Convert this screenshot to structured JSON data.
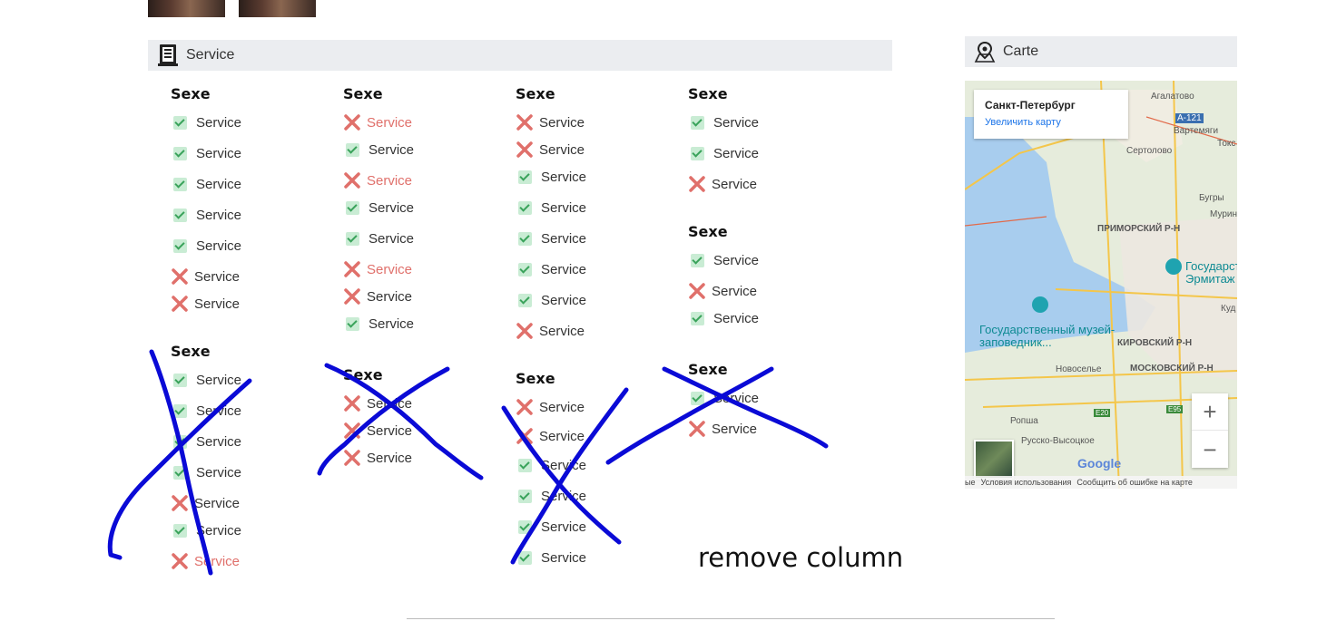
{
  "service_panel": {
    "title": "Service",
    "icon": "book-icon"
  },
  "map_panel": {
    "title": "Carte",
    "icon": "map-pin-icon"
  },
  "map": {
    "city": "Санкт-Петербург",
    "enlarge_link": "Увеличить карту",
    "zoom_in": "+",
    "zoom_out": "−",
    "labels": {
      "agalatovo": "Агалатово",
      "a121": "А-121",
      "vartemyagi": "Вартемяги",
      "toksovo": "Токс",
      "sertolovo": "Сертолово",
      "bugry": "Бугры",
      "murino": "Мурино",
      "primorsky": "ПРИМОРСКИЙ Р-Н",
      "hermitage": "Государственный Эрмитаж",
      "kud": "Куд",
      "museum": "Государственный музей-заповедник...",
      "kirovsky": "КИРОВСКИЙ Р-Н",
      "novoselye": "Новоселье",
      "moskovsky": "МОСКОВСКИЙ Р-Н",
      "ropsha": "Ропша",
      "russko": "Русско-Высоцкое",
      "e20": "E20",
      "e95": "E95",
      "google": "Google"
    },
    "footer": {
      "data": "ые",
      "terms": "Условия использования",
      "report": "Сообщить об ошибке на карте"
    }
  },
  "groups": [
    {
      "title": "Sexe",
      "items": [
        {
          "label": "Service",
          "status": "yes",
          "red": false
        },
        {
          "label": "Service",
          "status": "yes",
          "red": false
        },
        {
          "label": "Service",
          "status": "yes",
          "red": false
        },
        {
          "label": "Service",
          "status": "yes",
          "red": false
        },
        {
          "label": "Service",
          "status": "yes",
          "red": false
        },
        {
          "label": "Service",
          "status": "no",
          "red": false
        },
        {
          "label": "Service",
          "status": "no",
          "red": false
        }
      ]
    },
    {
      "title": "Sexe",
      "items": [
        {
          "label": "Service",
          "status": "yes",
          "red": false
        },
        {
          "label": "Service",
          "status": "yes",
          "red": false
        },
        {
          "label": "Service",
          "status": "yes",
          "red": false
        },
        {
          "label": "Service",
          "status": "yes",
          "red": false
        },
        {
          "label": "Service",
          "status": "no",
          "red": false
        },
        {
          "label": "Service",
          "status": "yes",
          "red": false
        },
        {
          "label": "Service",
          "status": "no",
          "red": true
        }
      ]
    },
    {
      "title": "Sexe",
      "items": [
        {
          "label": "Service",
          "status": "no",
          "red": true
        },
        {
          "label": "Service",
          "status": "yes",
          "red": false
        },
        {
          "label": "Service",
          "status": "no",
          "red": true
        },
        {
          "label": "Service",
          "status": "yes",
          "red": false
        },
        {
          "label": "Service",
          "status": "yes",
          "red": false
        },
        {
          "label": "Service",
          "status": "no",
          "red": true
        },
        {
          "label": "Service",
          "status": "no",
          "red": false
        },
        {
          "label": "Service",
          "status": "yes",
          "red": false
        }
      ]
    },
    {
      "title": "Sexe",
      "items": [
        {
          "label": "Service",
          "status": "no",
          "red": false
        },
        {
          "label": "Service",
          "status": "no",
          "red": false
        },
        {
          "label": "Service",
          "status": "no",
          "red": false
        }
      ]
    },
    {
      "title": "Sexe",
      "items": [
        {
          "label": "Service",
          "status": "no",
          "red": false
        },
        {
          "label": "Service",
          "status": "no",
          "red": false
        },
        {
          "label": "Service",
          "status": "yes",
          "red": false
        },
        {
          "label": "Service",
          "status": "yes",
          "red": false
        },
        {
          "label": "Service",
          "status": "yes",
          "red": false
        },
        {
          "label": "Service",
          "status": "yes",
          "red": false
        },
        {
          "label": "Service",
          "status": "yes",
          "red": false
        },
        {
          "label": "Service",
          "status": "no",
          "red": false
        }
      ]
    },
    {
      "title": "Sexe",
      "items": [
        {
          "label": "Service",
          "status": "no",
          "red": false
        },
        {
          "label": "Service",
          "status": "yes",
          "red": false
        },
        {
          "label": "Service",
          "status": "yes",
          "red": false
        },
        {
          "label": "Service",
          "status": "yes",
          "red": false
        },
        {
          "label": "Service",
          "status": "yes",
          "red": false
        },
        {
          "label": "Service",
          "status": "yes",
          "red": false
        }
      ]
    },
    {
      "title": "Sexe",
      "items": [
        {
          "label": "Service",
          "status": "yes",
          "red": false
        },
        {
          "label": "Service",
          "status": "yes",
          "red": false
        },
        {
          "label": "Service",
          "status": "no",
          "red": false
        }
      ]
    },
    {
      "title": "Sexe",
      "items": [
        {
          "label": "Service",
          "status": "yes",
          "red": false
        },
        {
          "label": "Service",
          "status": "no",
          "red": false
        },
        {
          "label": "Service",
          "status": "yes",
          "red": false
        }
      ]
    },
    {
      "title": "Sexe",
      "items": [
        {
          "label": "Service",
          "status": "yes",
          "red": false
        },
        {
          "label": "Service",
          "status": "no",
          "red": false
        }
      ]
    }
  ],
  "annotation": {
    "text": "remove column",
    "color": "#0a0ad6"
  },
  "colors": {
    "check_bg": "#c9ecd4",
    "check_mark": "#3aa35b",
    "cross": "#e0706b",
    "header_bg": "#ebedf0"
  }
}
